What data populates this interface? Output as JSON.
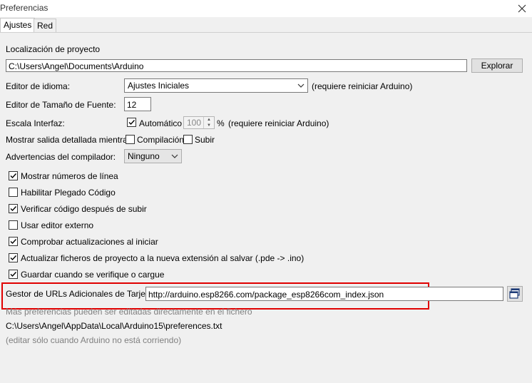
{
  "window": {
    "title": "Preferencias"
  },
  "tabs": [
    {
      "label": "Ajustes"
    },
    {
      "label": "Red"
    }
  ],
  "sketchbook": {
    "label": "Localización de proyecto",
    "path": "C:\\Users\\Angel\\Documents\\Arduino",
    "browse": "Explorar"
  },
  "language": {
    "label": "Editor de idioma:",
    "value": "Ajustes Iniciales",
    "note": "(requiere reiniciar Arduino)"
  },
  "font_size": {
    "label": "Editor de Tamaño de Fuente:",
    "value": "12"
  },
  "scale": {
    "label": "Escala Interfaz:",
    "auto_label": "Automático",
    "value": "100",
    "unit": "%",
    "note": "(requiere reiniciar Arduino)"
  },
  "verbose": {
    "label": "Mostrar salida detallada mientras:",
    "compile": "Compilación",
    "upload": "Subir"
  },
  "warnings": {
    "label": "Advertencias del compilador:",
    "value": "Ninguno"
  },
  "options": [
    {
      "label": "Mostrar números de línea",
      "checked": true
    },
    {
      "label": "Habilitar Plegado Código",
      "checked": false
    },
    {
      "label": "Verificar código después de subir",
      "checked": true
    },
    {
      "label": "Usar editor externo",
      "checked": false
    },
    {
      "label": "Comprobar actualizaciones al iniciar",
      "checked": true
    },
    {
      "label": "Actualizar ficheros de proyecto a la nueva extensión al salvar (.pde -> .ino)",
      "checked": true
    },
    {
      "label": "Guardar cuando se verifique o cargue",
      "checked": true
    }
  ],
  "boards_url": {
    "label": "Gestor de URLs Adicionales de Tarjetas:",
    "value": "http://arduino.esp8266.com/package_esp8266com_index.json"
  },
  "footer": {
    "more": "Más preferencias pueden ser editadas directamente en el fichero",
    "file": "C:\\Users\\Angel\\AppData\\Local\\Arduino15\\preferences.txt",
    "note": "(editar sólo cuando Arduino no está corriendo)"
  },
  "colors": {
    "highlight": "#e00000",
    "muted": "#808080"
  }
}
